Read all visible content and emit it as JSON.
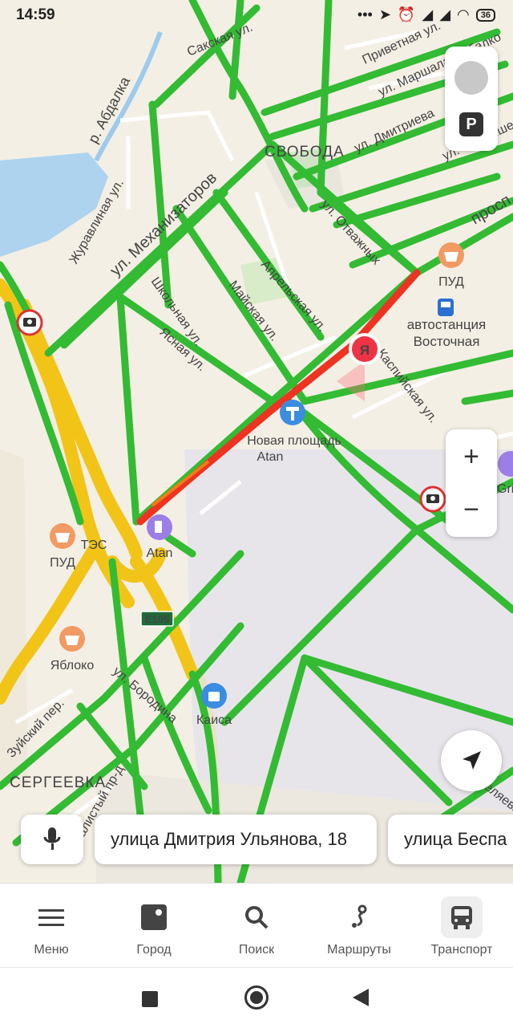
{
  "status_bar": {
    "time": "14:59",
    "icons": [
      "dots-icon",
      "location-arrow-icon",
      "alarm-icon",
      "signal-r-icon",
      "signal-r-icon",
      "wifi-icon",
      "battery-icon"
    ],
    "battery": "36"
  },
  "map": {
    "districts": [
      "СВОБОДА",
      "СЕРГЕЕВКА"
    ],
    "water_label": "р. Абдалка",
    "streets": [
      "Сакская ул.",
      "Приветная ул.",
      "ул. Маршала Рыбалко",
      "ул. Дмитриева",
      "ул. Чернышевского",
      "ул. Механизаторов",
      "Журавлиная ул.",
      "Школьная ул.",
      "Майская ул.",
      "Апрельская ул.",
      "ул. Отважных",
      "Ясная ул.",
      "Каспийская ул.",
      "ул. Бородина",
      "Зуйский пер.",
      "Скалистый пр-д",
      "просп.",
      "ул. Беляева"
    ],
    "highway_badge": "E105",
    "pois": [
      {
        "label": "ПУД",
        "icon": "basket-icon"
      },
      {
        "label": "автостанция Восточная",
        "icon": "bus-icon"
      },
      {
        "label": "Новая площадь Atan",
        "icon": "hammer-icon"
      },
      {
        "label": "Atan",
        "icon": "fuel-icon"
      },
      {
        "label": "ТЭС",
        "icon": "basket-icon"
      },
      {
        "label": "ПУД",
        "icon": "basket-icon"
      },
      {
        "label": "Яблоко",
        "icon": "basket-icon"
      },
      {
        "label": "Каиса",
        "icon": "shopping-bag-icon"
      },
      {
        "label": "Gri",
        "icon": "poi-icon"
      }
    ],
    "poi_labels": {
      "pud_right": "ПУД",
      "bus_line1": "автостанция",
      "bus_line2": "Восточная",
      "hammer_line1": "Новая площадь",
      "hammer_line2": "Atan",
      "fuel": "Atan",
      "tes": "ТЭС",
      "pud_left": "ПУД",
      "apple": "Яблоко",
      "kaisa": "Каиса",
      "gri": "Gri"
    },
    "location_marker": "Я",
    "traffic_colors": {
      "free": "#33bb33",
      "moderate": "#f2c418",
      "heavy": "#ee3322"
    }
  },
  "controls": {
    "zoom_in": "+",
    "zoom_out": "−",
    "parking": "P"
  },
  "search_suggestions": [
    {
      "text": "улица Дмитрия Ульянова, 18"
    },
    {
      "text": "улица Беспа"
    }
  ],
  "tabs": [
    {
      "label": "Меню",
      "icon": "menu-icon"
    },
    {
      "label": "Город",
      "icon": "city-icon"
    },
    {
      "label": "Поиск",
      "icon": "search-icon"
    },
    {
      "label": "Маршруты",
      "icon": "route-icon"
    },
    {
      "label": "Транспорт",
      "icon": "bus-icon",
      "active": true
    }
  ]
}
